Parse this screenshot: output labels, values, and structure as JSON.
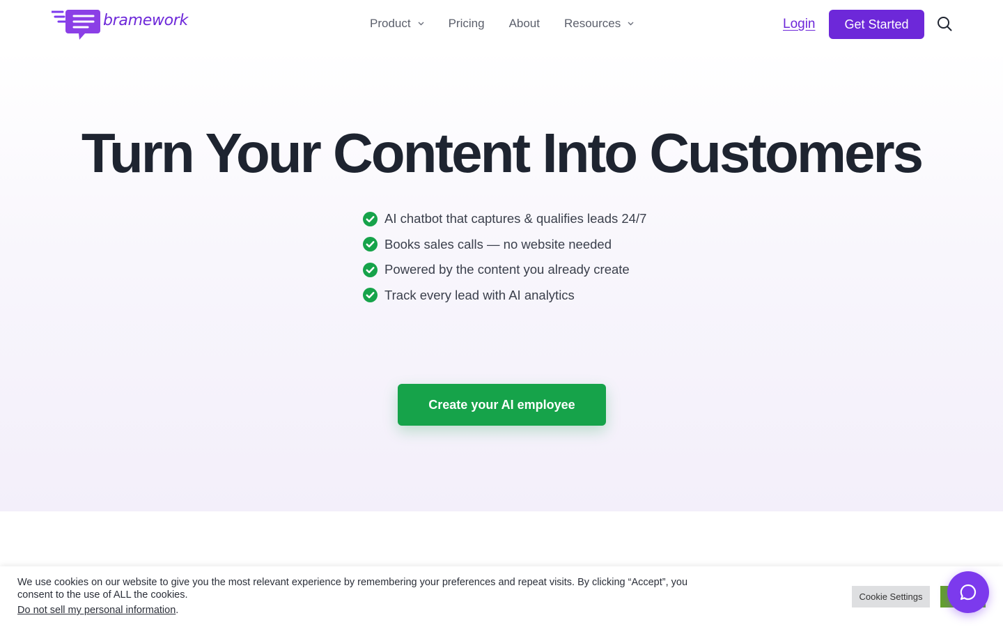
{
  "header": {
    "logo_text": "bramework",
    "nav": [
      {
        "label": "Product",
        "has_dropdown": true
      },
      {
        "label": "Pricing",
        "has_dropdown": false
      },
      {
        "label": "About",
        "has_dropdown": false
      },
      {
        "label": "Resources",
        "has_dropdown": true
      }
    ],
    "login_label": "Login",
    "get_started_label": "Get Started",
    "search_icon": "search-icon"
  },
  "hero": {
    "title": "Turn Your Content Into Customers",
    "features": [
      "AI chatbot that captures & qualifies leads 24/7",
      "Books sales calls — no website needed",
      "Powered by the content you already create",
      "Track every lead with AI analytics"
    ],
    "feature_icon": "check-circle-icon",
    "cta_label": "Create your AI employee"
  },
  "cookie": {
    "text": "We use cookies on our website to give you the most relevant experience by remembering your preferences and repeat visits. By clicking “Accept”, you consent to the use of ALL the cookies.",
    "dnt_link": "Do not sell my personal information",
    "dnt_suffix": ".",
    "settings_label": "Cookie Settings",
    "accept_label": ""
  },
  "chat_widget_icon": "chat-bubble-icon",
  "colors": {
    "brand_purple": "#6d28d9",
    "cta_green": "#16a34a",
    "check_green": "#16a34a",
    "accept_green": "#61a229",
    "title_dark": "#1e2430"
  }
}
